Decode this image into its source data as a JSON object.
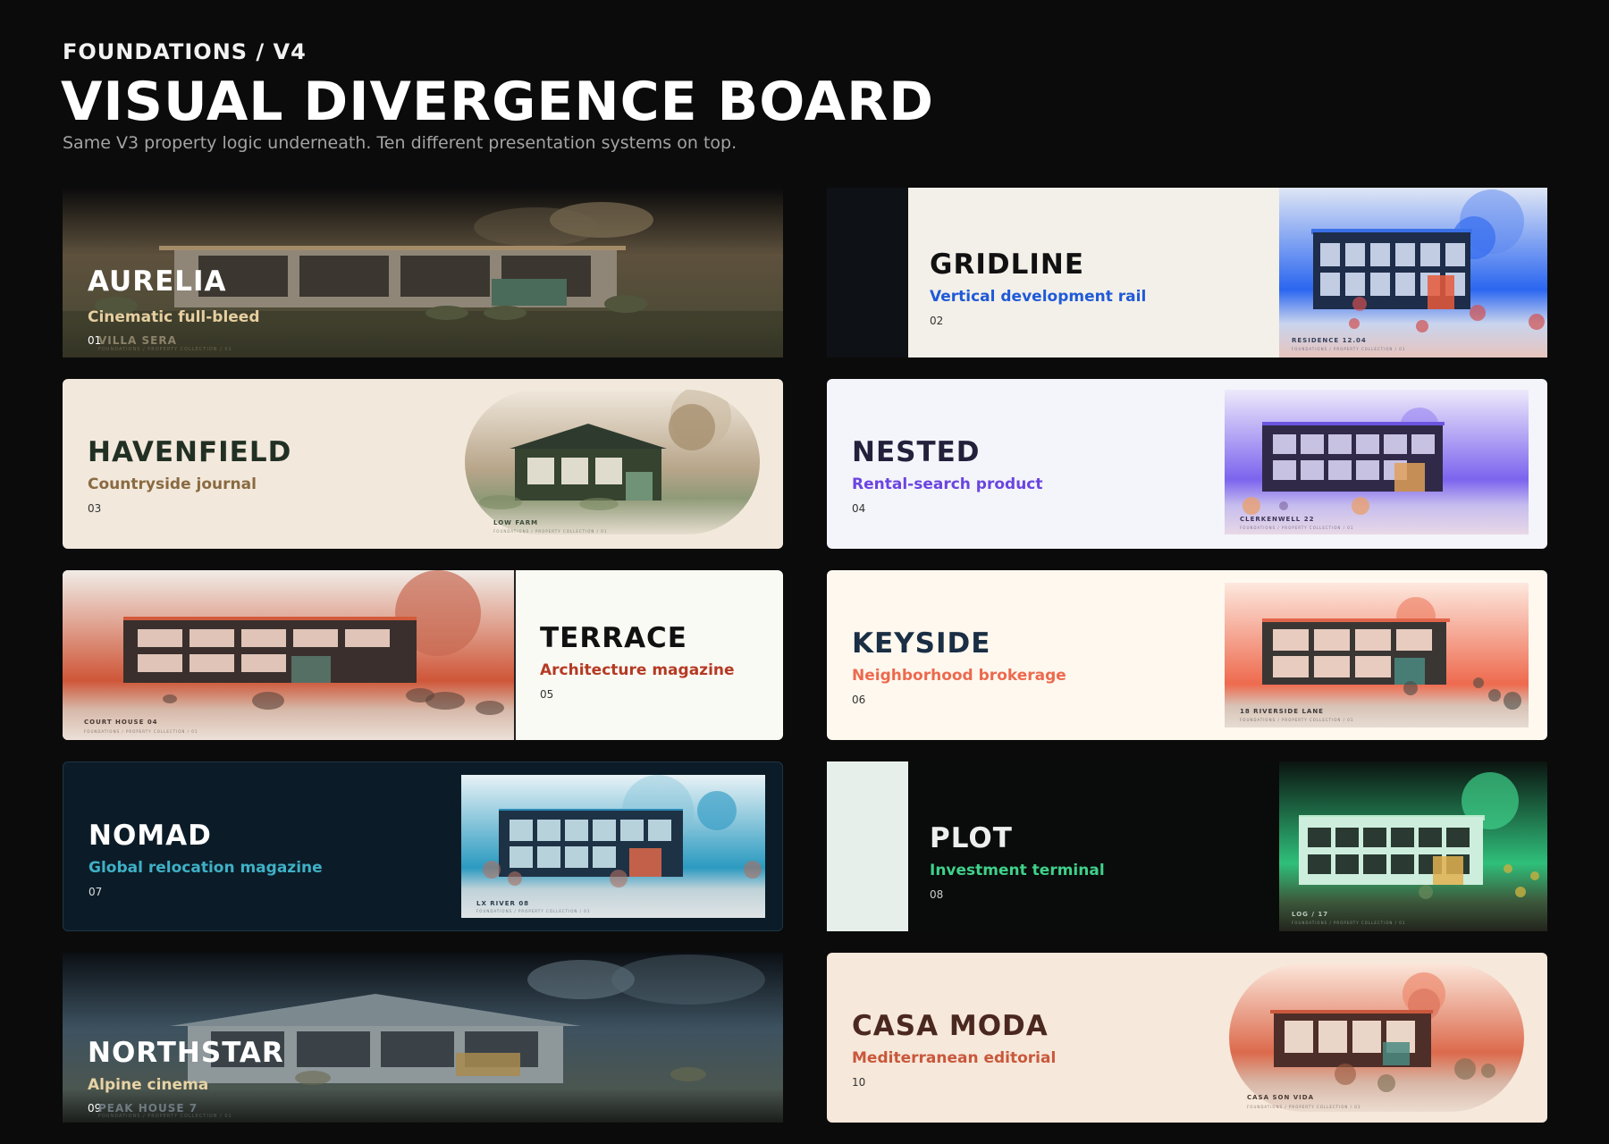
{
  "header": {
    "eyebrow": "FOUNDATIONS / V4",
    "title": "VISUAL DIVERGENCE BOARD",
    "subtitle": "Same V3 property logic underneath. Ten different presentation systems on top."
  },
  "cards": [
    {
      "name": "AURELIA",
      "tagline": "Cinematic full-bleed",
      "number": "01",
      "caption": "VILLA SERA",
      "accent": "#e6cfa0"
    },
    {
      "name": "GRIDLINE",
      "tagline": "Vertical development rail",
      "number": "02",
      "caption": "RESIDENCE 12.04",
      "accent": "#1f5ad8"
    },
    {
      "name": "HAVENFIELD",
      "tagline": "Countryside journal",
      "number": "03",
      "caption": "LOW FARM",
      "accent": "#8a6a42"
    },
    {
      "name": "NESTED",
      "tagline": "Rental-search product",
      "number": "04",
      "caption": "CLERKENWELL 22",
      "accent": "#6a45e0"
    },
    {
      "name": "TERRACE",
      "tagline": "Architecture magazine",
      "number": "05",
      "caption": "COURT HOUSE 04",
      "accent": "#b53a24"
    },
    {
      "name": "KEYSIDE",
      "tagline": "Neighborhood brokerage",
      "number": "06",
      "caption": "18 RIVERSIDE LANE",
      "accent": "#ec6a4e"
    },
    {
      "name": "NOMAD",
      "tagline": "Global relocation magazine",
      "number": "07",
      "caption": "LX RIVER 08",
      "accent": "#3fb0c6"
    },
    {
      "name": "PLOT",
      "tagline": "Investment terminal",
      "number": "08",
      "caption": "LOG / 17",
      "accent": "#3fd18a"
    },
    {
      "name": "NORTHSTAR",
      "tagline": "Alpine cinema",
      "number": "09",
      "caption": "PEAK HOUSE 7",
      "accent": "#e8d3a4"
    },
    {
      "name": "CASA MODA",
      "tagline": "Mediterranean editorial",
      "number": "10",
      "caption": "CASA SON VIDA",
      "accent": "#c9583c"
    }
  ],
  "footer_caption": "FOUNDATIONS / PROPERTY COLLECTION / 01"
}
